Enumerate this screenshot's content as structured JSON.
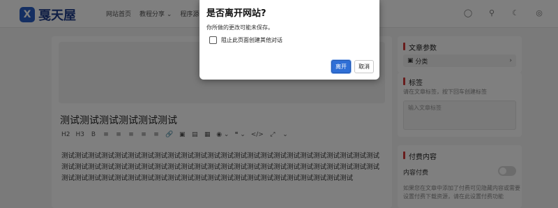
{
  "header": {
    "logo_mark": "X",
    "logo_text": "戛天屋",
    "nav": [
      "网站首页",
      "教程分享 ⌄",
      "程序源码"
    ]
  },
  "editor": {
    "title": "测试测试测试测试测试测试",
    "toolbar": [
      "H2",
      "H3",
      "B",
      "≡",
      "≡",
      "≡",
      "≡",
      "≡",
      "🔗",
      "▣",
      "▤",
      "▦",
      "◉ ⌄",
      "❝ ⌄",
      "</>",
      "⤢",
      "⌄"
    ],
    "content": "测试测试测试测试测试测试测试测试测试测试测试测试测试测试测试测试测试测试测试测试测试测试测试测试测试测试测试测试测试测试测试测试测试测试测试测试测试测试测试测试测试测试测试测试测试测试测试测试测试测试测试测试测试测试测试测试测试测试测试测试测试测试测试测试测试测试测试测试测试测试"
  },
  "sidebar": {
    "article_params": {
      "title": "文章参数",
      "category": "分类"
    },
    "tags": {
      "title": "标签",
      "hint": "请在文章标签，按下回车创建标签",
      "placeholder": "输入文章标签"
    },
    "paid": {
      "title": "付费内容",
      "toggle_label": "内容付费",
      "hint1": "如果您在文章中添加了付费可见隐藏内容或需要",
      "hint2": "设置付费下载资源，请在此设置付费功能"
    }
  },
  "dialog": {
    "title": "是否离开网站?",
    "message": "你所做的更改可能未保存。",
    "checkbox_label": "阻止此页面创建其他对话",
    "leave_label": "离开",
    "cancel_label": "取消"
  }
}
